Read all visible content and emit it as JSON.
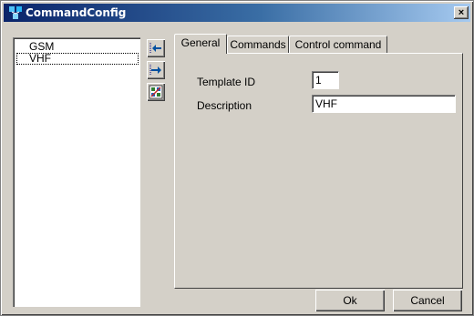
{
  "window": {
    "title": "CommandConfig",
    "close_label": "×"
  },
  "templates": [
    {
      "label": "GSM",
      "selected": false
    },
    {
      "label": "VHF",
      "selected": true
    }
  ],
  "toolbar": {
    "buttons": [
      "move-left-icon",
      "move-right-icon",
      "config-icon"
    ]
  },
  "tabs": [
    {
      "label": "General",
      "active": true
    },
    {
      "label": "Commands",
      "active": false
    },
    {
      "label": "Control command",
      "active": false
    }
  ],
  "general": {
    "template_id_label": "Template ID",
    "template_id_value": "1",
    "description_label": "Description",
    "description_value": "VHF"
  },
  "actions": {
    "ok_label": "Ok",
    "cancel_label": "Cancel"
  },
  "colors": {
    "titlebar_start": "#0a246a",
    "titlebar_end": "#a6caf0",
    "face": "#d4d0c8"
  }
}
